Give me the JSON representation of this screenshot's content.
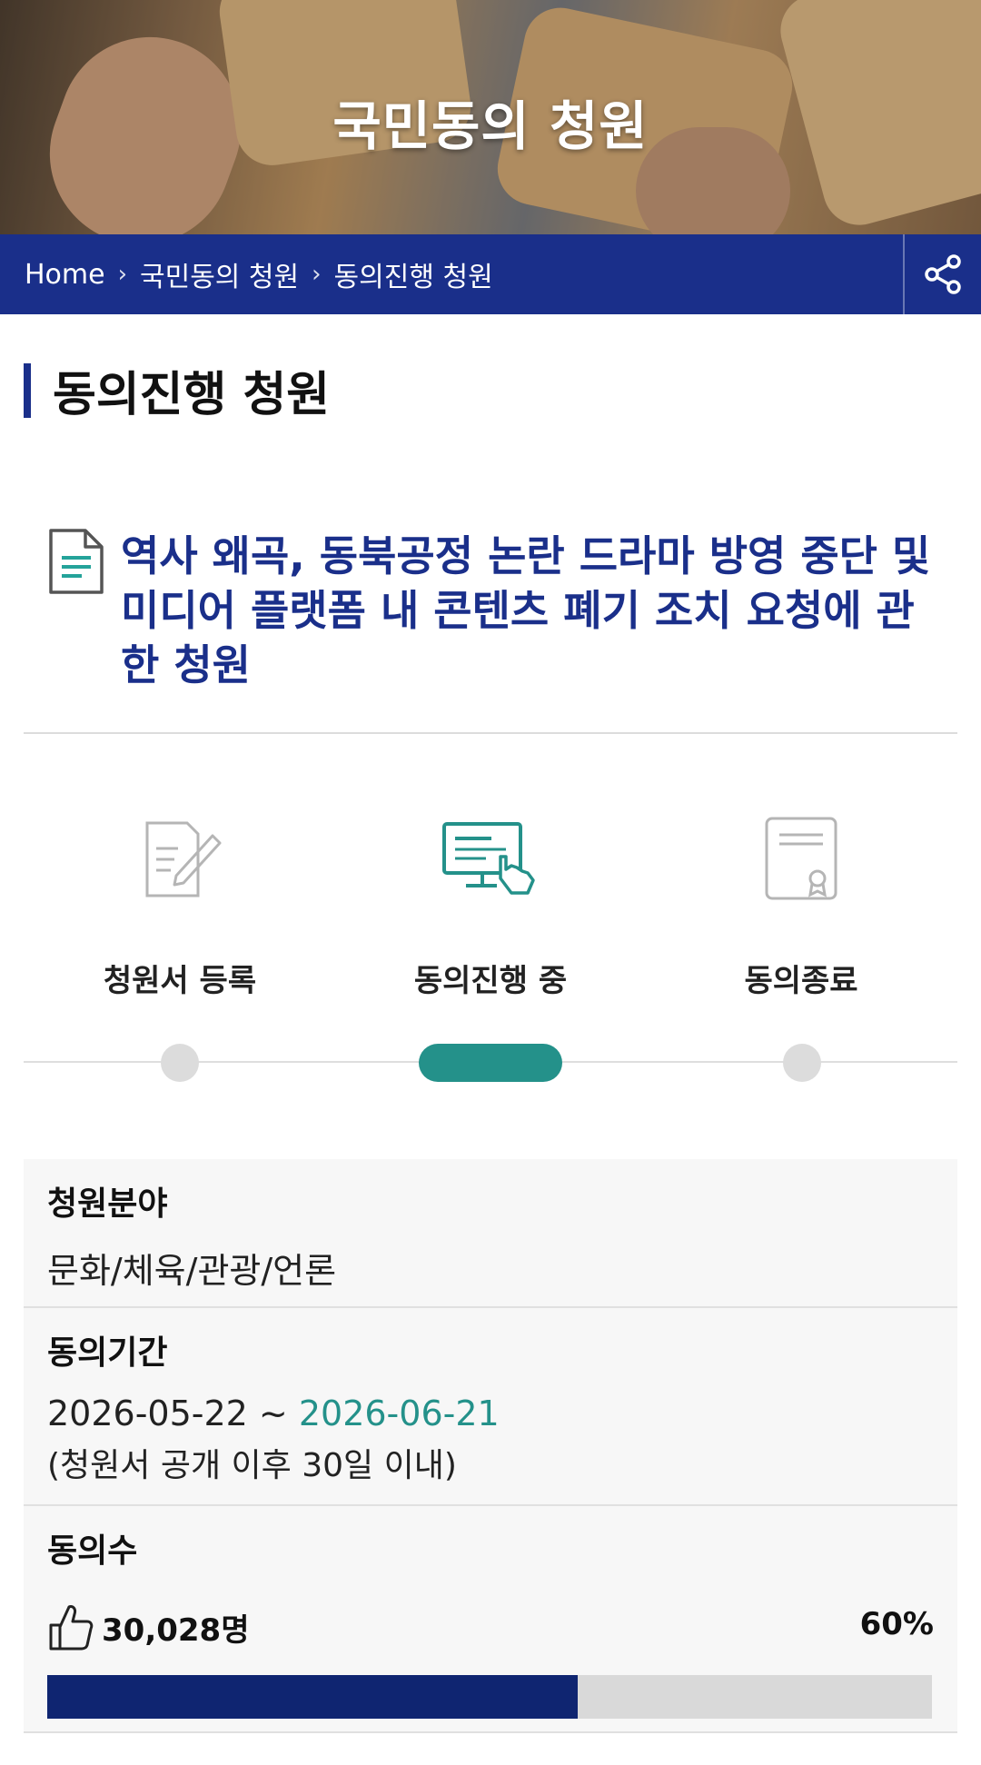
{
  "hero": {
    "title": "국민동의 청원"
  },
  "breadcrumb": {
    "items": [
      "Home",
      "국민동의 청원",
      "동의진행 청원"
    ]
  },
  "page": {
    "heading": "동의진행 청원"
  },
  "petition": {
    "title": "역사 왜곡, 동북공정 논란 드라마 방영 중단 및 미디어 플랫폼 내 콘텐츠 폐기 조치 요청에 관한 청원"
  },
  "steps": [
    {
      "label": "청원서 등록",
      "icon": "document-edit-icon",
      "active": false
    },
    {
      "label": "동의진행 중",
      "icon": "computer-click-icon",
      "active": true
    },
    {
      "label": "동의종료",
      "icon": "certificate-icon",
      "active": false
    }
  ],
  "info": {
    "field": {
      "label": "청원분야",
      "value": "문화/체육/관광/언론"
    },
    "period": {
      "label": "동의기간",
      "start": "2026-05-22",
      "separator": " ~ ",
      "end": "2026-06-21",
      "note": "(청원서 공개 이후 30일 이내)"
    },
    "agree": {
      "label": "동의수",
      "count": "30,028명",
      "percent_label": "60%",
      "progress": 0.6
    }
  },
  "colors": {
    "navy": "#1a2f8a",
    "teal": "#24918a",
    "progress_fill": "#0f2571"
  }
}
